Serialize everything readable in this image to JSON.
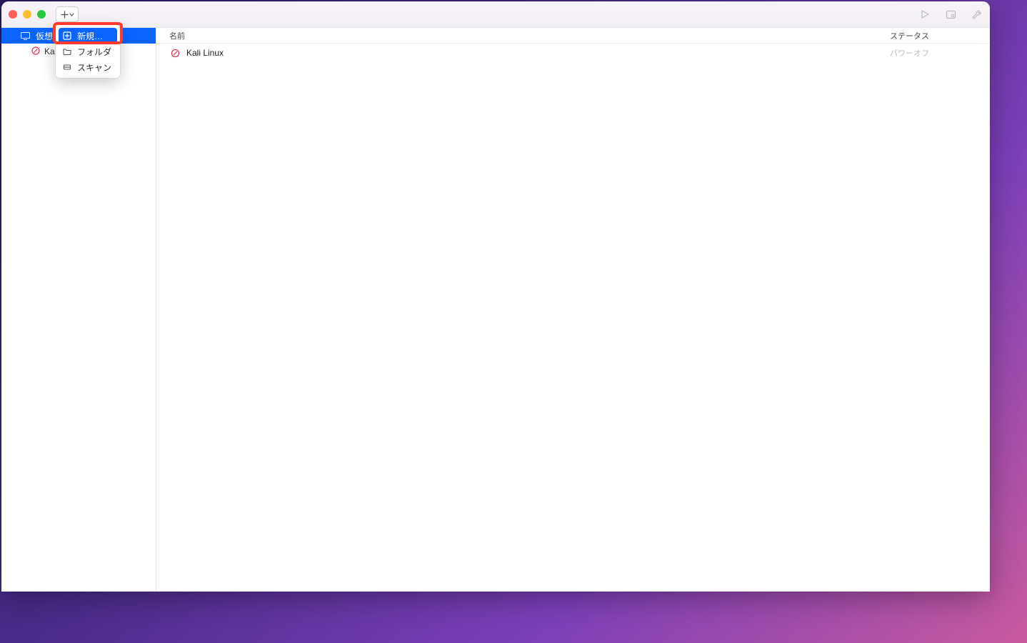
{
  "sidebar": {
    "group_label": "仮想",
    "items": [
      {
        "label": "Ka"
      }
    ]
  },
  "menu": {
    "new": "新規…",
    "folder": "フォルダ",
    "scan": "スキャン"
  },
  "columns": {
    "name": "名前",
    "status": "ステータス"
  },
  "rows": [
    {
      "name": "Kali Linux",
      "status": "パワーオフ"
    }
  ],
  "icons": {
    "plus": "plus-icon",
    "chevron": "chevron-down-icon",
    "play": "play-icon",
    "settings": "settings-icon",
    "wrench": "wrench-icon",
    "display": "display-icon",
    "stop": "stop-icon",
    "new": "new-icon",
    "folder": "folder-icon",
    "scan": "scan-icon"
  },
  "colors": {
    "accent": "#0a64ff",
    "highlight": "#ff3b30"
  }
}
